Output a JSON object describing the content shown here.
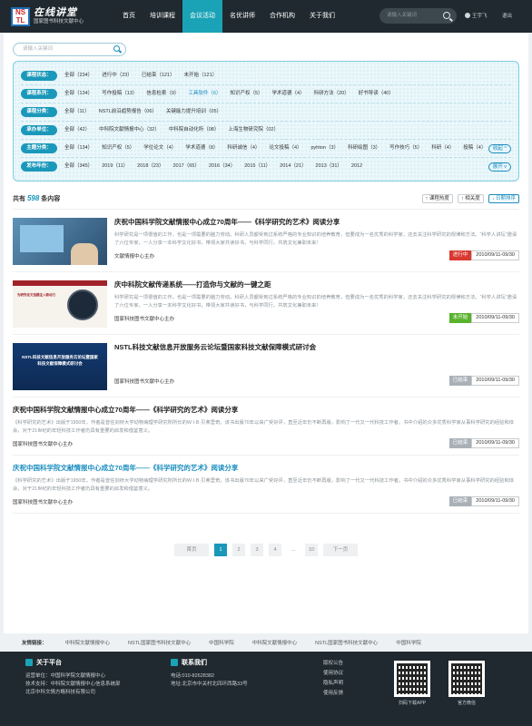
{
  "header": {
    "logo_badge_top": "NS",
    "logo_badge_bottom": "TL",
    "logo_title": "在线讲堂",
    "logo_subtitle": "国家图书科技文献中心",
    "nav": [
      "首页",
      "培训课程",
      "会议活动",
      "名优讲师",
      "合作机构",
      "关于我们"
    ],
    "nav_active": 2,
    "search_placeholder": "请输入关键词",
    "user_name": "王宇飞",
    "logout": "退出"
  },
  "search": {
    "placeholder": "请输入关键词"
  },
  "filters": [
    {
      "label": "课程状态：",
      "options": [
        "全部（234）",
        "进行中（23）",
        "已结束（121）",
        "未开始（121）"
      ],
      "selected": -1
    },
    {
      "label": "课程系列：",
      "options": [
        "全部（134）",
        "写作投稿（13）",
        "信息检索（9）",
        "工具软件（6）",
        "知识产权（5）",
        "学术道德（4）",
        "科研方法（20）",
        "好书导读（40）"
      ],
      "selected": 3
    },
    {
      "label": "课程分类：",
      "options": [
        "全部（11）",
        "NSTL前沿趋势报告（06）",
        "关键能力提升培训（05）"
      ],
      "selected": -1
    },
    {
      "label": "承办单位：",
      "options": [
        "全部（42）",
        "中科院文献情报中心（32）",
        "中科院自动化所（08）",
        "上海生物研究院（02）"
      ],
      "selected": -1
    },
    {
      "label": "主题分类：",
      "options": [
        "全部（134）",
        "知识产权（5）",
        "学位论文（4）",
        "学术道德（8）",
        "科研诚信（4）",
        "论文投稿（4）",
        "pyhton（3）",
        "科研绘图（3）",
        "写作技巧（5）",
        "科研（4）",
        "投稿（4）"
      ],
      "selected": -1,
      "button": "收起 ^"
    },
    {
      "label": "发布年份：",
      "options": [
        "全部（345）",
        "2019（11）",
        "2018（23）",
        "2017（65）",
        "2016（34）",
        "2015（11）",
        "2014（21）",
        "2013（31）",
        "2012"
      ],
      "selected": -1,
      "button": "展开 v"
    }
  ],
  "list": {
    "count_prefix": "共有",
    "count": "598",
    "count_suffix": "条内容",
    "sorts": [
      "↑ 课程热度",
      "↑ 相关度",
      "↓ 日期排序"
    ]
  },
  "items": [
    {
      "title": "庆祝中国科学院文献情报中心成立70周年——《科学研究的艺术》阅读分享",
      "desc": "科学研究是一项很值的工作，也是一项需要的脑力劳动。科研人员都受到过系统严格的专业知识的培养教育，但要成为一名优秀的科学家，还去关注科学研究的规律和方法。“科学人讲坛”邀请了六位专家，一人分享一本科学文化好书，带领大家共读好书，与科学同行，共筑文化兼职未来！",
      "org": "文献情报中心主办",
      "status": "进行中",
      "status_color": "#d9392f",
      "date": "2010/09/11-09/30",
      "title_blue": false,
      "has_thumb": true
    },
    {
      "title": "庆中科院文献传递系统——打造你与文献的一键之距",
      "desc": "科学研究是一项很值的工作，也是一项需要的脑力劳动。科研人员都受到过系统严格的专业知识的培养教育，但要成为一名优秀的科学家，还去关注科学研究的规律和方法。“科学人讲坛”邀请了六位专家，一人分享一本科学文化好书，带领大家共读好书，与科学同行，共筑文化兼职未来！",
      "org": "国家科技图书文献中心主办",
      "status": "未开始",
      "status_color": "#58b22a",
      "date": "2010/09/11-09/30",
      "title_blue": false,
      "has_thumb": true,
      "thumb_text": "为研究论文选题注入新动力",
      "thumb_logo": "Elsevier"
    },
    {
      "title": "NSTL科技文献信息开放服务云论坛暨国家科技文献保障模式研讨会",
      "desc": "",
      "org": "国家科技图书文献中心主办",
      "status": "已结束",
      "status_color": "#a9b1b7",
      "date": "2010/09/11-09/30",
      "title_blue": false,
      "has_thumb": true,
      "thumb_text": "NSTL科技文献信息开放服务云论坛暨国家科技文献保障模式研讨会"
    },
    {
      "title": "庆祝中国科学院文献情报中心成立70周年——《科学研究的艺术》阅读分享",
      "desc": "《科学研究的艺术》出版于1950年，作者是曾任剑桥大学动物病理学研究所所长的W·I·B·贝弗里奇。该书出版70年以来广受好评，直至近年仍不断再版，影响了一代又一代科技工作者。书中介绍的众多优秀科学家从事科学研究的经验和体会，对于21世纪的年轻科技工作者仍具有重要的启发和借鉴意义。",
      "org": "国家科技图书文献中心主办",
      "status": "已结束",
      "status_color": "#a9b1b7",
      "date": "2010/09/11-09/30",
      "title_blue": false,
      "has_thumb": false
    },
    {
      "title": "庆祝中国科学院文献情报中心成立70周年——《科学研究的艺术》阅读分享",
      "desc": "《科学研究的艺术》出版于1950年，作者是曾任剑桥大学动物病理学研究所所长的W·I·B·贝弗里奇。该书出版70年以来广受好评，直至近年仍不断再版，影响了一代又一代科技工作者。书中介绍的众多优秀科学家从事科学研究的经验和体会，对于21世纪的年轻科技工作者仍具有重要的启发和借鉴意义。",
      "org": "国家科技图书文献中心主办",
      "status": "已结束",
      "status_color": "#a9b1b7",
      "date": "2010/09/11-09/30",
      "title_blue": true,
      "has_thumb": false
    }
  ],
  "pager": {
    "prev": "首页",
    "pages": [
      "1",
      "2",
      "3",
      "4"
    ],
    "dots": "...",
    "last": "10",
    "next": "下一页",
    "active": 0
  },
  "links": {
    "label": "友情链接：",
    "items": [
      "中科院文献情报中心",
      "NSTL国家图书科技文献中心",
      "中国科学院",
      "中科院文献情报中心",
      "NSTL国家图书科技文献中心",
      "中国科学院"
    ]
  },
  "footer": {
    "about_title": "关于平台",
    "about_lines": [
      "运营单位：中国科学院文献情报中心",
      "技术支持：中科院文献情报中心信息系统部",
      "北京中科文情方略科技有限公司"
    ],
    "contact_title": "联系我们",
    "contact_lines": [
      "电话:010-82628382",
      "地址:北京市中关村北四环西路33号"
    ],
    "policy": [
      "版权公告",
      "使用协议",
      "隐私声明",
      "使用反馈"
    ],
    "qr1": "扫码下载APP",
    "qr2": "官方微信"
  }
}
